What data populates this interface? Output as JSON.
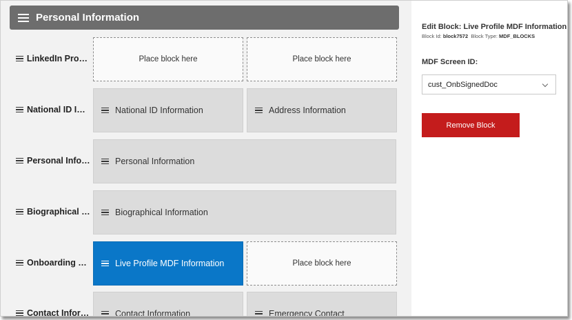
{
  "header": {
    "title": "Personal Information"
  },
  "rows": [
    {
      "label": "LinkedIn Profile",
      "blocks": [
        "Place block here",
        "Place block here"
      ]
    },
    {
      "label": "National ID In…",
      "blocks": [
        "National ID Information",
        "Address Information"
      ]
    },
    {
      "label": "Personal Info…",
      "blocks": [
        "Personal Information"
      ]
    },
    {
      "label": "Biographical …",
      "blocks": [
        "Biographical Information"
      ]
    },
    {
      "label": "Onboarding …",
      "blocks": [
        "Live Profile MDF Information",
        "Place block here"
      ]
    },
    {
      "label": "Contact Infor…",
      "blocks": [
        "Contact Information",
        "Emergency Contact"
      ]
    }
  ],
  "panel": {
    "edit_title": "Edit Block:  Live Profile MDF Information",
    "block_id_label": "Block Id:",
    "block_id": "block7572",
    "block_type_label": "Block Type:",
    "block_type": "MDF_BLOCKS",
    "mdf_label": "MDF Screen ID:",
    "mdf_value": "cust_OnbSignedDoc",
    "remove_label": "Remove Block"
  },
  "colors": {
    "header_bg": "#6d6d6d",
    "active_block": "#0a77c8",
    "remove_button": "#c41c1c"
  },
  "icons": {
    "menu": "hamburger-icon",
    "drag": "drag-handle-icon",
    "dropdown": "chevron-down-icon"
  }
}
